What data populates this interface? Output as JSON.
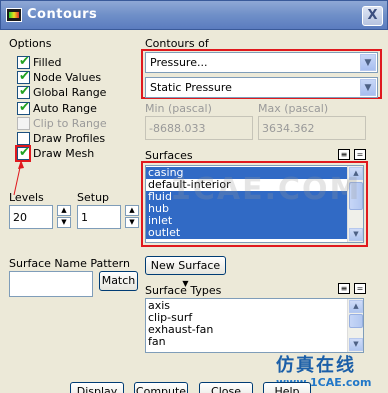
{
  "window": {
    "title": "Contours",
    "close_glyph": "X"
  },
  "options": {
    "heading": "Options",
    "checkboxes": [
      {
        "label": "Filled",
        "checked": true,
        "enabled": true
      },
      {
        "label": "Node Values",
        "checked": true,
        "enabled": true
      },
      {
        "label": "Global Range",
        "checked": true,
        "enabled": true
      },
      {
        "label": "Auto Range",
        "checked": true,
        "enabled": true
      },
      {
        "label": "Clip to Range",
        "checked": false,
        "enabled": false
      },
      {
        "label": "Draw Profiles",
        "checked": false,
        "enabled": true
      },
      {
        "label": "Draw Mesh",
        "checked": true,
        "enabled": true
      }
    ]
  },
  "contours_of": {
    "heading": "Contours of",
    "category": "Pressure...",
    "quantity": "Static Pressure"
  },
  "range": {
    "min_label": "Min (pascal)",
    "min_value": "-8688.033",
    "max_label": "Max (pascal)",
    "max_value": "3634.362"
  },
  "levels": {
    "label": "Levels",
    "value": "20"
  },
  "setup": {
    "label": "Setup",
    "value": "1"
  },
  "surfaces": {
    "heading": "Surfaces",
    "items": [
      {
        "label": "casing",
        "selected": true
      },
      {
        "label": "default-interior",
        "selected": false
      },
      {
        "label": "fluid",
        "selected": true
      },
      {
        "label": "hub",
        "selected": true
      },
      {
        "label": "inlet",
        "selected": true
      },
      {
        "label": "outlet",
        "selected": true
      }
    ]
  },
  "surface_name_pattern": {
    "label": "Surface Name Pattern",
    "value": "",
    "match_label": "Match"
  },
  "new_surface_label": "New Surface",
  "surface_types": {
    "heading": "Surface Types",
    "items": [
      "axis",
      "clip-surf",
      "exhaust-fan",
      "fan"
    ]
  },
  "bottom_buttons": {
    "display": "Display",
    "compute": "Compute",
    "close": "Close",
    "help": "Help"
  },
  "brand": {
    "chinese": "仿真在线",
    "url": "www.1CAE.com",
    "watermark": "1CAE.COM"
  },
  "colors": {
    "highlight": "#316ac5",
    "annotation_red": "#e0191e",
    "titlebar": "#6f8fc8"
  }
}
